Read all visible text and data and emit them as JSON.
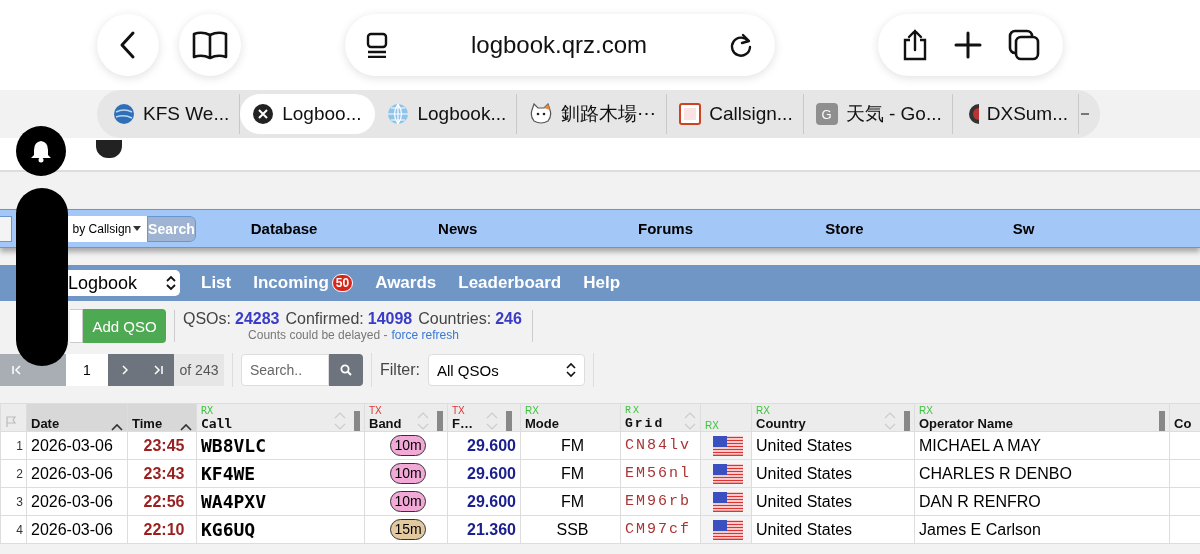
{
  "browser": {
    "url": "logbook.qrz.com"
  },
  "tabs": [
    {
      "label": "KFS We...",
      "selected": false
    },
    {
      "label": "Logboo...",
      "selected": true
    },
    {
      "label": "Logbook...",
      "selected": false
    },
    {
      "label": "釧路木場⋯",
      "selected": false
    },
    {
      "label": "Callsign...",
      "selected": false
    },
    {
      "label": "天気 - Go...",
      "selected": false,
      "letter": "G"
    },
    {
      "label": "DXSum...",
      "selected": false
    }
  ],
  "site_nav": {
    "search_mode": "by Callsign",
    "search_button": "Search",
    "links": [
      "Database",
      "News",
      "Forums",
      "Store",
      "Sw"
    ]
  },
  "logbook_bar": {
    "logbook_select": "Logbook",
    "menu": [
      {
        "label": "List"
      },
      {
        "label": "Incoming",
        "badge": "50"
      },
      {
        "label": "Awards"
      },
      {
        "label": "Leaderboard"
      },
      {
        "label": "Help"
      }
    ]
  },
  "stats": {
    "add_button": "Add QSO",
    "items": [
      {
        "label": "QSOs:",
        "value": "24283"
      },
      {
        "label": "Confirmed:",
        "value": "14098"
      },
      {
        "label": "Countries:",
        "value": "246"
      }
    ],
    "note": "Counts could be delayed -",
    "refresh_link": "force refresh"
  },
  "pager": {
    "page": "1",
    "of_pages": "of 243",
    "search_placeholder": "Search..",
    "filter_label": "Filter:",
    "filter_value": "All QSOs"
  },
  "table": {
    "columns": [
      {
        "label": "Date",
        "sorted": true,
        "kind": "date"
      },
      {
        "label": "Time",
        "sorted": true,
        "kind": "time"
      },
      {
        "label": "Call",
        "tag": "RX",
        "sorted": false,
        "sortable": true,
        "kind": "call"
      },
      {
        "label": "Band",
        "tag": "TX",
        "sorted": false,
        "sortable": true,
        "kind": "band"
      },
      {
        "label": "F…",
        "tag": "TX",
        "sorted": false,
        "sortable": true,
        "kind": "freq"
      },
      {
        "label": "Mode",
        "tag": "RX",
        "sorted": false,
        "kind": "mode"
      },
      {
        "label": "Grid",
        "tag": "RX",
        "sorted": false,
        "sortable": true,
        "kind": "grid"
      },
      {
        "tag": "RX",
        "sorted": false,
        "kind": "flag"
      },
      {
        "label": "Country",
        "tag": "RX",
        "sorted": false,
        "sortable": true,
        "kind": "country"
      },
      {
        "label": "Operator Name",
        "tag": "RX",
        "sorted": false,
        "kind": "name"
      },
      {
        "label": "Co",
        "sorted": false,
        "kind": "extra"
      }
    ],
    "rows": [
      {
        "num": "1",
        "date": "2026-03-06",
        "time": "23:45",
        "call": "WB8VLC",
        "band": {
          "label": "10m",
          "color": "#f2a9d8"
        },
        "freq": "29.600",
        "mode": "FM",
        "grid": "CN84lv",
        "country": "United States",
        "name": "MICHAEL A MAY"
      },
      {
        "num": "2",
        "date": "2026-03-06",
        "time": "23:43",
        "call": "KF4WE",
        "band": {
          "label": "10m",
          "color": "#f2a9d8"
        },
        "freq": "29.600",
        "mode": "FM",
        "grid": "EM56nl",
        "country": "United States",
        "name": "CHARLES R DENBO"
      },
      {
        "num": "3",
        "date": "2026-03-06",
        "time": "22:56",
        "call": "WA4PXV",
        "band": {
          "label": "10m",
          "color": "#f2a9d8"
        },
        "freq": "29.600",
        "mode": "FM",
        "grid": "EM96rb",
        "country": "United States",
        "name": "DAN R RENFRO"
      },
      {
        "num": "4",
        "date": "2026-03-06",
        "time": "22:10",
        "call": "KG6UQ",
        "band": {
          "label": "15m",
          "color": "#e2c9a0"
        },
        "freq": "21.360",
        "mode": "SSB",
        "grid": "CM97cf",
        "country": "United States",
        "name": "James E Carlson"
      }
    ]
  }
}
